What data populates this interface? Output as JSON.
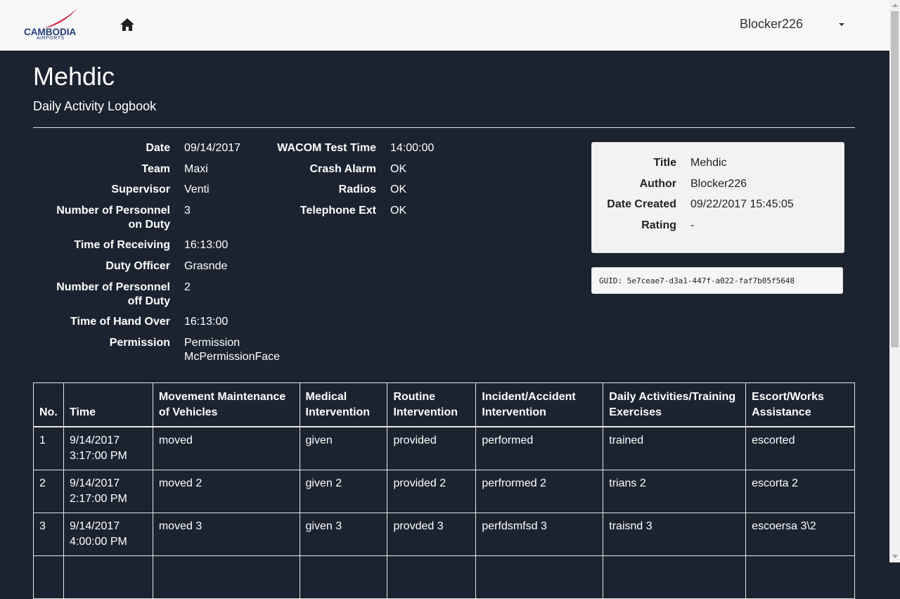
{
  "brand": {
    "name": "CAMBODIA",
    "sub": "AIRPORTS",
    "accent": "#c8102e",
    "navy": "#1f3b7a"
  },
  "nav": {
    "user": "Blocker226"
  },
  "page": {
    "title": "Mehdic",
    "subtitle": "Daily Activity Logbook"
  },
  "fields_left": [
    {
      "label": "Date",
      "value": "09/14/2017"
    },
    {
      "label": "Team",
      "value": "Maxi"
    },
    {
      "label": "Supervisor",
      "value": "Venti"
    },
    {
      "label": "Number of Personnel on Duty",
      "value": "3"
    },
    {
      "label": "Time of Receiving",
      "value": "16:13:00"
    },
    {
      "label": "Duty Officer",
      "value": "Grasnde"
    },
    {
      "label": "Number of Personnel off Duty",
      "value": "2"
    },
    {
      "label": "Time of Hand Over",
      "value": "16:13:00"
    },
    {
      "label": "Permission",
      "value": "Permission McPermissionFace"
    }
  ],
  "fields_mid": [
    {
      "label": "WACOM Test Time",
      "value": "14:00:00"
    },
    {
      "label": "Crash Alarm",
      "value": "OK"
    },
    {
      "label": "Radios",
      "value": "OK"
    },
    {
      "label": "Telephone Ext",
      "value": "OK"
    }
  ],
  "meta": [
    {
      "label": "Title",
      "value": "Mehdic"
    },
    {
      "label": "Author",
      "value": "Blocker226"
    },
    {
      "label": "Date Created",
      "value": "09/22/2017 15:45:05"
    },
    {
      "label": "Rating",
      "value": "-"
    }
  ],
  "guid": "GUID: 5e7ceae7-d3a1-447f-a022-faf7b05f5648",
  "table": {
    "headers": [
      "No.",
      "Time",
      "Movement Maintenance of Vehicles",
      "Medical Intervention",
      "Routine Intervention",
      "Incident/Accident Intervention",
      "Daily Activities/Training Exercises",
      "Escort/Works Assistance"
    ],
    "rows": [
      [
        "1",
        "9/14/2017 3:17:00 PM",
        "moved",
        "given",
        "provided",
        "performed",
        "trained",
        "escorted"
      ],
      [
        "2",
        "9/14/2017 2:17:00 PM",
        "moved 2",
        "given 2",
        "provided 2",
        "perfrormed 2",
        "trians 2",
        "escorta 2"
      ],
      [
        "3",
        "9/14/2017 4:00:00 PM",
        "moved 3",
        "given 3",
        "provded 3",
        "perfdsmfsd 3",
        "traisnd 3",
        "escoersa 3\\2"
      ],
      [
        "",
        "",
        "",
        "",
        "",
        "",
        "",
        ""
      ]
    ]
  }
}
